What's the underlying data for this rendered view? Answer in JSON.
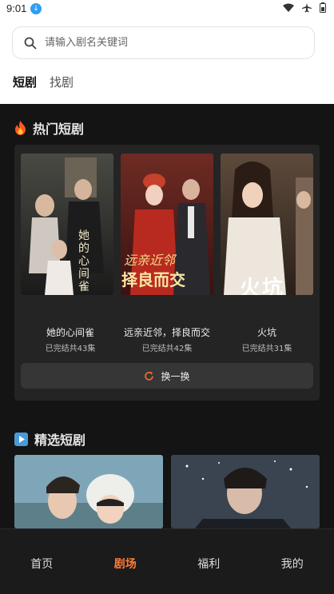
{
  "status": {
    "time": "9:01"
  },
  "search": {
    "placeholder": "请输入剧名关键词"
  },
  "tabs": [
    {
      "label": "短剧"
    },
    {
      "label": "找剧"
    }
  ],
  "hot": {
    "title": "热门短剧",
    "dramas": [
      {
        "title": "她的心间雀",
        "status": "已完结共43集",
        "poster_text": "她的心间雀"
      },
      {
        "title": "远亲近邻，择良而交",
        "status": "已完结共42集",
        "poster_text_1": "远亲近邻",
        "poster_text_2": "择良而交"
      },
      {
        "title": "火坑",
        "status": "已完结共31集",
        "poster_text": "火坑"
      }
    ],
    "refresh_label": "换一换"
  },
  "featured": {
    "title": "精选短剧"
  },
  "nav": [
    {
      "label": "首页"
    },
    {
      "label": "剧场"
    },
    {
      "label": "福利"
    },
    {
      "label": "我的"
    }
  ],
  "colors": {
    "accent": "#ff7a33",
    "background": "#141414",
    "card": "#242424"
  }
}
